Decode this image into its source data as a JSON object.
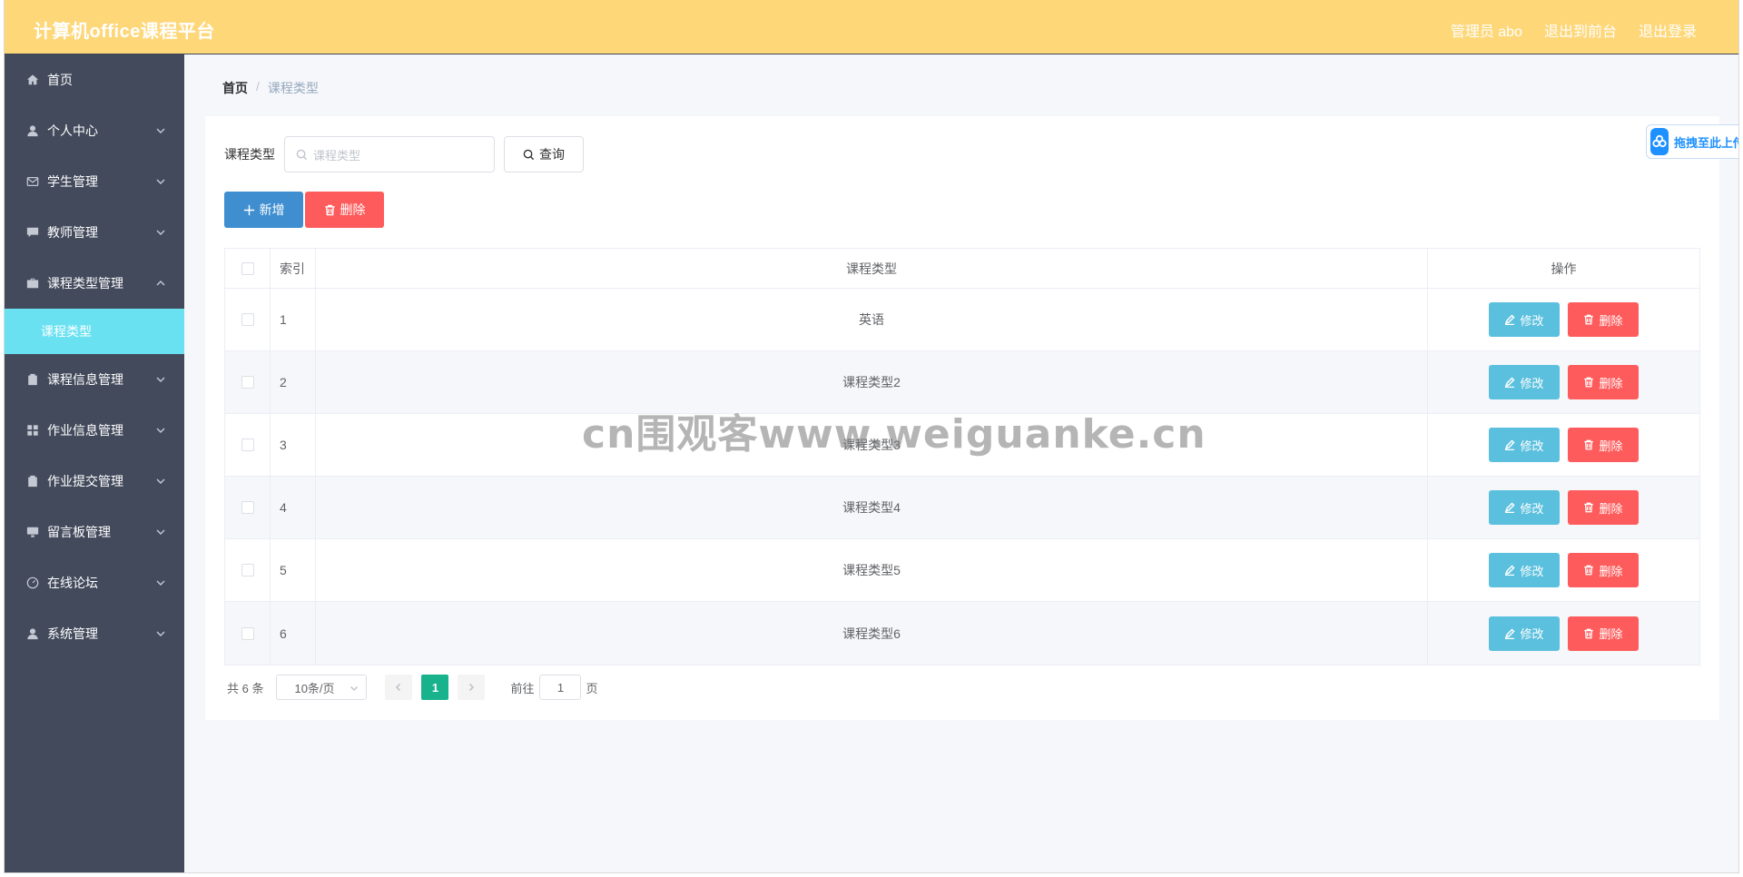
{
  "header": {
    "title": "计算机office课程平台",
    "user": "管理员 abo",
    "to_front": "退出到前台",
    "logout": "退出登录"
  },
  "sidebar": {
    "items": [
      {
        "label": "首页",
        "icon": "home-icon",
        "expandable": false
      },
      {
        "label": "个人中心",
        "icon": "user-icon",
        "expandable": true
      },
      {
        "label": "学生管理",
        "icon": "mail-icon",
        "expandable": true
      },
      {
        "label": "教师管理",
        "icon": "chat-icon",
        "expandable": true
      },
      {
        "label": "课程类型管理",
        "icon": "briefcase-icon",
        "expandable": true,
        "expanded": true,
        "children": [
          {
            "label": "课程类型",
            "active": true
          }
        ]
      },
      {
        "label": "课程信息管理",
        "icon": "clipboard-icon",
        "expandable": true
      },
      {
        "label": "作业信息管理",
        "icon": "grid-icon",
        "expandable": true
      },
      {
        "label": "作业提交管理",
        "icon": "clipboard-check-icon",
        "expandable": true
      },
      {
        "label": "留言板管理",
        "icon": "monitor-icon",
        "expandable": true
      },
      {
        "label": "在线论坛",
        "icon": "speedometer-icon",
        "expandable": true
      },
      {
        "label": "系统管理",
        "icon": "user-icon",
        "expandable": true
      }
    ],
    "active_bg": "#6ae1f1",
    "bg": "#434a5c"
  },
  "breadcrumb": {
    "home": "首页",
    "separator": "/",
    "current": "课程类型"
  },
  "search": {
    "label": "课程类型",
    "placeholder": "课程类型",
    "query_button": "查询"
  },
  "actions": {
    "add": "新增",
    "delete": "删除"
  },
  "table": {
    "headers": {
      "index": "索引",
      "type": "课程类型",
      "ops": "操作"
    },
    "rows": [
      {
        "index": "1",
        "type": "英语"
      },
      {
        "index": "2",
        "type": "课程类型2"
      },
      {
        "index": "3",
        "type": "课程类型3"
      },
      {
        "index": "4",
        "type": "课程类型4"
      },
      {
        "index": "5",
        "type": "课程类型5"
      },
      {
        "index": "6",
        "type": "课程类型6"
      }
    ],
    "edit_label": "修改",
    "delete_label": "删除"
  },
  "pagination": {
    "total": "共 6 条",
    "page_size": "10条/页",
    "current_page": "1",
    "goto_prefix": "前往",
    "goto_value": "1",
    "goto_suffix": "页"
  },
  "drop_widget": {
    "label": "拖拽至此上传"
  },
  "watermark": "cn围观客www.weiguanke.cn",
  "colors": {
    "header_bg": "#fed779",
    "add_button": "#3f8ed0",
    "delete_button": "#fe5c5c",
    "edit_button": "#5bc0de",
    "pager_active": "#18b38d"
  }
}
